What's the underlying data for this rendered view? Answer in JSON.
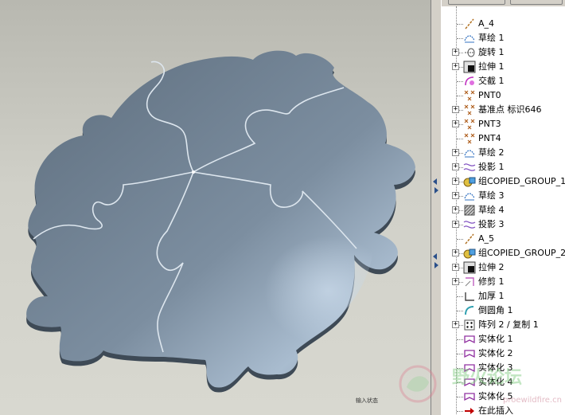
{
  "viewport": {
    "status_text": "输入状态"
  },
  "tree": {
    "items": [
      {
        "label": "A_4",
        "icon": "datum-axis-icon",
        "expandable": false
      },
      {
        "label": "草绘 1",
        "icon": "sketch-icon",
        "expandable": false
      },
      {
        "label": "旋转 1",
        "icon": "revolve-icon",
        "expandable": true
      },
      {
        "label": "拉伸 1",
        "icon": "extrude-icon",
        "expandable": true
      },
      {
        "label": "交截 1",
        "icon": "intersect-icon",
        "expandable": false
      },
      {
        "label": "PNT0",
        "icon": "datum-point-icon",
        "expandable": false
      },
      {
        "label": "基准点 标识646",
        "icon": "datum-point-icon",
        "expandable": true
      },
      {
        "label": "PNT3",
        "icon": "datum-point-icon",
        "expandable": true
      },
      {
        "label": "PNT4",
        "icon": "datum-point-icon",
        "expandable": false
      },
      {
        "label": "草绘 2",
        "icon": "sketch-icon",
        "expandable": true
      },
      {
        "label": "投影 1",
        "icon": "projection-icon",
        "expandable": true
      },
      {
        "label": "组COPIED_GROUP_1",
        "icon": "group-icon",
        "expandable": true
      },
      {
        "label": "草绘 3",
        "icon": "sketch-icon",
        "expandable": true
      },
      {
        "label": "草绘 4",
        "icon": "sketch-hatched-icon",
        "expandable": true
      },
      {
        "label": "投影 3",
        "icon": "projection-icon",
        "expandable": true
      },
      {
        "label": "A_5",
        "icon": "datum-axis-icon",
        "expandable": false
      },
      {
        "label": "组COPIED_GROUP_2",
        "icon": "group-icon",
        "expandable": true
      },
      {
        "label": "拉伸 2",
        "icon": "extrude-icon",
        "expandable": true
      },
      {
        "label": "修剪 1",
        "icon": "trim-icon",
        "expandable": true
      },
      {
        "label": "加厚 1",
        "icon": "thicken-icon",
        "expandable": false
      },
      {
        "label": "倒圆角 1",
        "icon": "round-icon",
        "expandable": false
      },
      {
        "label": "阵列 2 / 复制 1",
        "icon": "pattern-icon",
        "expandable": true
      },
      {
        "label": "实体化 1",
        "icon": "solidify-icon",
        "expandable": false
      },
      {
        "label": "实体化 2",
        "icon": "solidify-icon",
        "expandable": false
      },
      {
        "label": "实体化 3",
        "icon": "solidify-icon",
        "expandable": false
      },
      {
        "label": "实体化 4",
        "icon": "solidify-icon",
        "expandable": false
      },
      {
        "label": "实体化 5",
        "icon": "solidify-icon",
        "expandable": false
      },
      {
        "label": "在此插入",
        "icon": "insert-here-arrow-icon",
        "expandable": false
      }
    ]
  },
  "watermark": {
    "text": "野火论坛",
    "url": "proewildfire.cn"
  },
  "colors": {
    "puzzle": "#6e7f90",
    "highlight": "#b4c6d8",
    "arrow": "#c00000"
  }
}
